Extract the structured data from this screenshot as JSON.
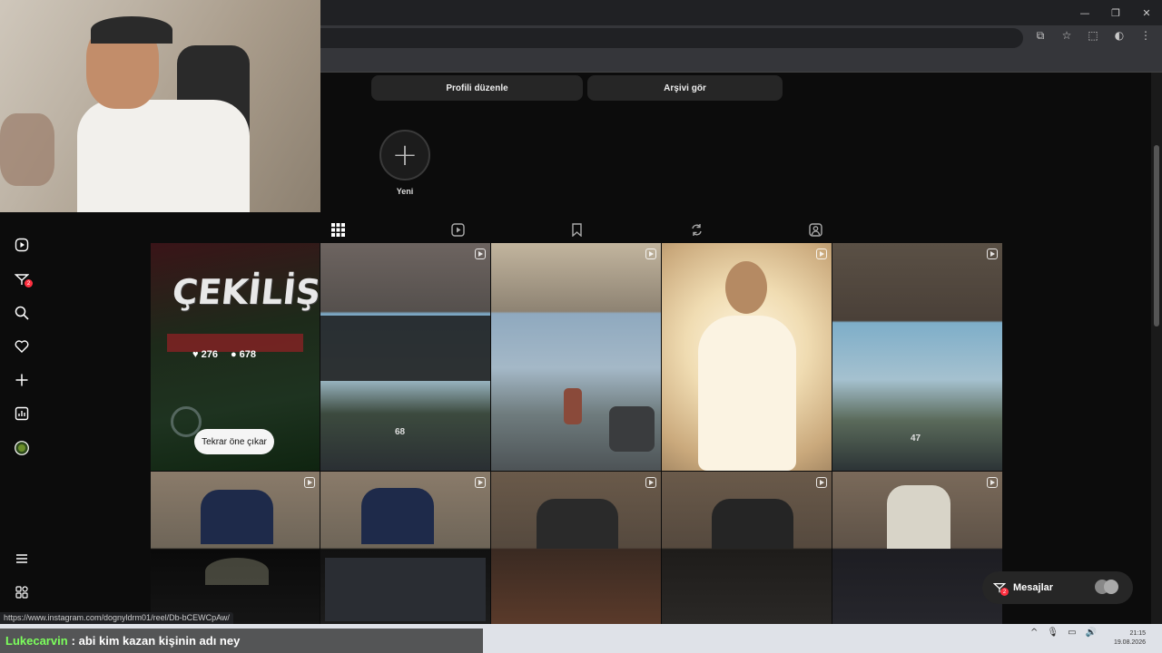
{
  "window": {
    "minimize": "—",
    "restore": "❐",
    "close": "✕"
  },
  "toolbar_icons": {
    "cast": "⧉",
    "star": "☆",
    "extensions": "⬚",
    "profile": "◐",
    "menu": "⋮"
  },
  "profile": {
    "edit_label": "Profili düzenle",
    "archive_label": "Arşivi gör",
    "new_story_symbol": "+",
    "new_story_label": "Yeni"
  },
  "tabs": [
    {
      "name": "posts",
      "icon": "grid-icon"
    },
    {
      "name": "reels",
      "icon": "reels-icon"
    },
    {
      "name": "saved",
      "icon": "bookmark-icon"
    },
    {
      "name": "reposts",
      "icon": "repost-icon"
    },
    {
      "name": "tagged",
      "icon": "tagged-icon"
    }
  ],
  "sidebar": {
    "notification_badge": "2",
    "icons": [
      "reels-icon",
      "messages-icon",
      "search-icon",
      "heart-icon",
      "create-icon",
      "insights-icon",
      "profile-avatar-icon",
      "menu-icon",
      "more-apps-icon"
    ]
  },
  "post_overlay": {
    "title": "ÇEKİLİŞ",
    "likes": "276",
    "comments": "678",
    "pin_button": "Tekrar öne çıkar"
  },
  "tiles": {
    "t1_counter": "68",
    "t2_counter": "47"
  },
  "messages": {
    "label": "Mesajlar",
    "badge": "2"
  },
  "status_url": "https://www.instagram.com/dognyldrm01/reel/Db-bCEWCpAw/",
  "chat": {
    "user": "Lukecarvin",
    "message": ": abi kim kazan kişinin adı ney"
  },
  "clock": {
    "time": "21:15",
    "date": "19.08.2026"
  },
  "colors": {
    "accent_badge": "#ff3040",
    "chat_user": "#7cff5c",
    "page_bg": "#0c0c0c"
  }
}
